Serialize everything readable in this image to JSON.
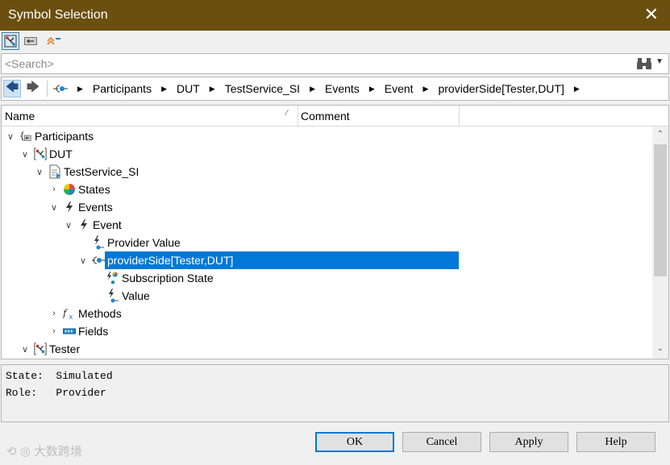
{
  "window": {
    "title": "Symbol Selection",
    "close_icon": "close-icon"
  },
  "toolbar": {
    "buttons": [
      {
        "icon": "participant-view-icon",
        "active": true
      },
      {
        "icon": "interface-view-icon",
        "active": false
      },
      {
        "icon": "collapse-all-icon",
        "active": false
      }
    ]
  },
  "search": {
    "placeholder": "<Search>",
    "value": ""
  },
  "breadcrumb": {
    "items": [
      "Participants",
      "DUT",
      "TestService_SI",
      "Events",
      "Event",
      "providerSide[Tester,DUT]"
    ]
  },
  "tree": {
    "columns": {
      "name": "Name",
      "comment": "Comment"
    },
    "rows": [
      {
        "label": "Participants",
        "icon": "participants-icon",
        "level": 0,
        "expanded": true
      },
      {
        "label": "DUT",
        "icon": "participant-icon",
        "level": 1,
        "expanded": true
      },
      {
        "label": "TestService_SI",
        "icon": "service-interface-icon",
        "level": 2,
        "expanded": true
      },
      {
        "label": "States",
        "icon": "states-icon",
        "level": 3,
        "expanded": false
      },
      {
        "label": "Events",
        "icon": "events-icon",
        "level": 3,
        "expanded": true
      },
      {
        "label": "Event",
        "icon": "event-icon",
        "level": 4,
        "expanded": true
      },
      {
        "label": "Provider Value",
        "icon": "value-icon",
        "level": 5,
        "expanded": null
      },
      {
        "label": "providerSide[Tester,DUT]",
        "icon": "provider-side-icon",
        "level": 5,
        "expanded": true,
        "selected": true
      },
      {
        "label": "Subscription State",
        "icon": "subscription-state-icon",
        "level": 6,
        "expanded": null
      },
      {
        "label": "Value",
        "icon": "value-icon",
        "level": 6,
        "expanded": null
      },
      {
        "label": "Methods",
        "icon": "methods-icon",
        "level": 3,
        "expanded": false
      },
      {
        "label": "Fields",
        "icon": "fields-icon",
        "level": 3,
        "expanded": false
      },
      {
        "label": "Tester",
        "icon": "participant-icon",
        "level": 1,
        "expanded": true
      }
    ]
  },
  "properties": {
    "lines": [
      "State:  Simulated",
      "Role:   Provider"
    ]
  },
  "buttons": {
    "ok": "OK",
    "cancel": "Cancel",
    "apply": "Apply",
    "help": "Help"
  },
  "watermark": "大数跨境",
  "colors": {
    "titlebar": "#6b4f10",
    "selection": "#0078d7",
    "accent": "#1e88c8"
  }
}
